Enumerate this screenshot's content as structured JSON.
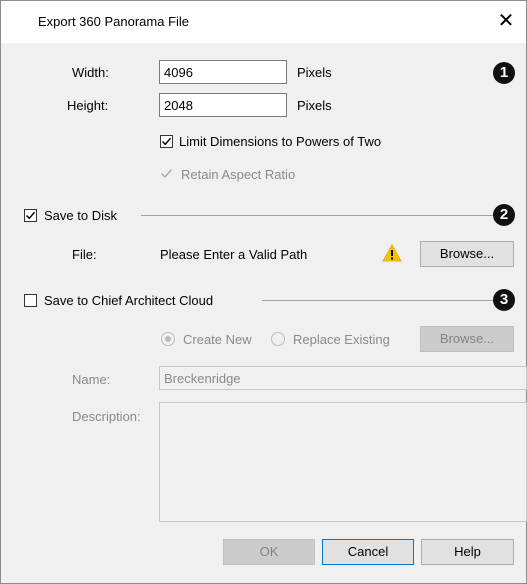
{
  "window": {
    "title": "Export 360 Panorama File",
    "close_glyph": "✕"
  },
  "dimensions": {
    "width_label": "Width:",
    "width_value": "4096",
    "width_unit": "Pixels",
    "height_label": "Height:",
    "height_value": "2048",
    "height_unit": "Pixels",
    "limit_powers_label": "Limit Dimensions to Powers of Two",
    "limit_powers_checked": true,
    "retain_aspect_label": "Retain Aspect Ratio",
    "retain_aspect_checked": true,
    "retain_aspect_enabled": false
  },
  "save_to_disk": {
    "label": "Save to Disk",
    "checked": true,
    "file_label": "File:",
    "file_value": "Please Enter a Valid Path",
    "warning_icon": "warning-icon",
    "browse_label": "Browse..."
  },
  "save_to_cloud": {
    "label": "Save to Chief Architect Cloud",
    "checked": false,
    "create_new_label": "Create New",
    "create_new_selected": true,
    "replace_existing_label": "Replace Existing",
    "browse_label": "Browse...",
    "name_label": "Name:",
    "name_value": "Breckenridge",
    "description_label": "Description:",
    "description_value": ""
  },
  "callouts": [
    "1",
    "2",
    "3"
  ],
  "footer": {
    "ok_label": "OK",
    "cancel_label": "Cancel",
    "help_label": "Help"
  },
  "colors": {
    "warning": "#f5c400",
    "accent": "#0078d7"
  }
}
